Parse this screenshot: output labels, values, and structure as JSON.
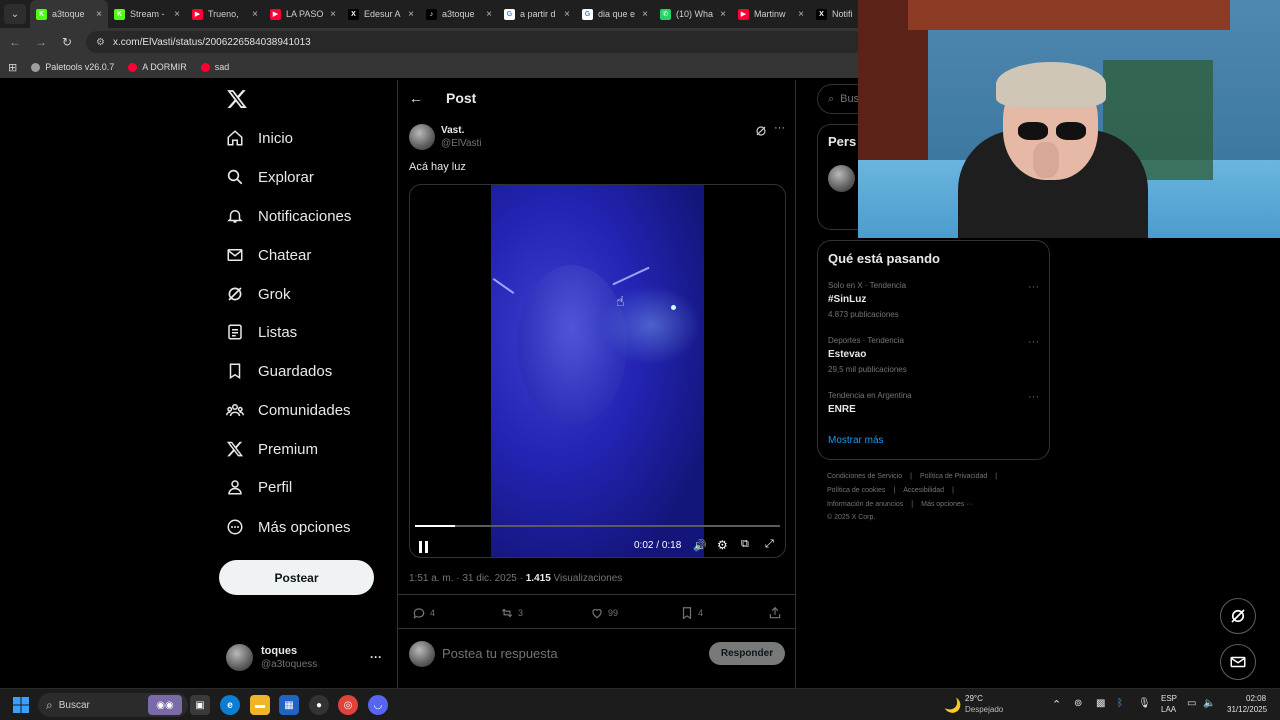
{
  "browser": {
    "tabs": [
      {
        "label": "a3toque",
        "fav_color": "#53fc18",
        "fav_char": "K",
        "active": true
      },
      {
        "label": "Stream -",
        "fav_color": "#53fc18",
        "fav_char": "K",
        "active": false
      },
      {
        "label": "Trueno, ",
        "fav_color": "#ff0033",
        "fav_char": "▶",
        "active": false
      },
      {
        "label": "LA PASO",
        "fav_color": "#ff0033",
        "fav_char": "▶",
        "active": false
      },
      {
        "label": "Edesur A",
        "fav_color": "#000000",
        "fav_char": "X",
        "active": false
      },
      {
        "label": "a3toque",
        "fav_color": "#000000",
        "fav_char": "♪",
        "active": false
      },
      {
        "label": "a partir d",
        "fav_color": "#ffffff",
        "fav_char": "G",
        "active": false
      },
      {
        "label": "dia que e",
        "fav_color": "#ffffff",
        "fav_char": "G",
        "active": false
      },
      {
        "label": "(10) Wha",
        "fav_color": "#25d366",
        "fav_char": "✆",
        "active": false
      },
      {
        "label": "Martinw",
        "fav_color": "#ff0033",
        "fav_char": "▶",
        "active": false
      },
      {
        "label": "Notifi",
        "fav_color": "#000000",
        "fav_char": "X",
        "active": false
      }
    ],
    "url": "x.com/ElVasti/status/2006226584038941013",
    "bookmarks": [
      {
        "label": "Paletools v26.0.7",
        "color": "#9e9e9e"
      },
      {
        "label": "A DORMIR",
        "color": "#ff0033"
      },
      {
        "label": "sad",
        "color": "#ff0033"
      }
    ]
  },
  "sidebar": {
    "logo": "X",
    "items": [
      {
        "label": "Inicio",
        "icon": "home-icon"
      },
      {
        "label": "Explorar",
        "icon": "search-icon"
      },
      {
        "label": "Notificaciones",
        "icon": "bell-icon"
      },
      {
        "label": "Chatear",
        "icon": "mail-icon"
      },
      {
        "label": "Grok",
        "icon": "grok-icon"
      },
      {
        "label": "Listas",
        "icon": "list-icon"
      },
      {
        "label": "Guardados",
        "icon": "bookmark-icon"
      },
      {
        "label": "Comunidades",
        "icon": "communities-icon"
      },
      {
        "label": "Premium",
        "icon": "x-premium-icon"
      },
      {
        "label": "Perfil",
        "icon": "person-icon"
      },
      {
        "label": "Más opciones",
        "icon": "more-circle-icon"
      }
    ],
    "post_button": "Postear",
    "account": {
      "name": "toques",
      "handle": "@a3toquess",
      "more": "···"
    }
  },
  "post": {
    "header_title": "Post",
    "author_name": "Vast.",
    "author_handle": "@ElVasti",
    "text": "Acá hay luz",
    "video": {
      "current": "0:02",
      "separator": "/",
      "duration": "0:18",
      "progress": 0.11
    },
    "timestamp": "1:51 a. m. · 31 dic. 2025 · ",
    "views_count": "1.415",
    "views_label": " Visualizaciones",
    "actions": {
      "replies": "4",
      "reposts": "3",
      "likes": "99",
      "bookmarks": "4"
    },
    "reply_placeholder": "Postea tu respuesta",
    "reply_button": "Responder"
  },
  "right": {
    "search_placeholder": "Busca",
    "who_to_follow_title": "Pers",
    "trends_title": "Qué está pasando",
    "trends": [
      {
        "meta": "Solo en X · Tendencia",
        "name": "#SinLuz",
        "count": "4.873 publicaciones"
      },
      {
        "meta": "Deportes · Tendencia",
        "name": "Estevao",
        "count": "29,5 mil publicaciones"
      },
      {
        "meta": "Tendencia en Argentina",
        "name": "ENRE",
        "count": ""
      }
    ],
    "show_more": "Mostrar más",
    "footer": {
      "row1": [
        "Condiciones de Servicio",
        "Política de Privacidad"
      ],
      "row2": [
        "Política de cookies",
        "Accesibilidad"
      ],
      "row3": [
        "Información de anuncios",
        "Más opciones ···"
      ],
      "copyright": "© 2025 X Corp."
    }
  },
  "taskbar": {
    "search_placeholder": "Buscar",
    "weather_temp": "29°C",
    "weather_desc": "Despejado",
    "lang_top": "ESP",
    "lang_bottom": "LAA",
    "time": "02:08",
    "date": "31/12/2025"
  },
  "colors": {
    "accent_blue": "#1d9bf0",
    "muted": "#71767b",
    "border": "#2f3336"
  }
}
